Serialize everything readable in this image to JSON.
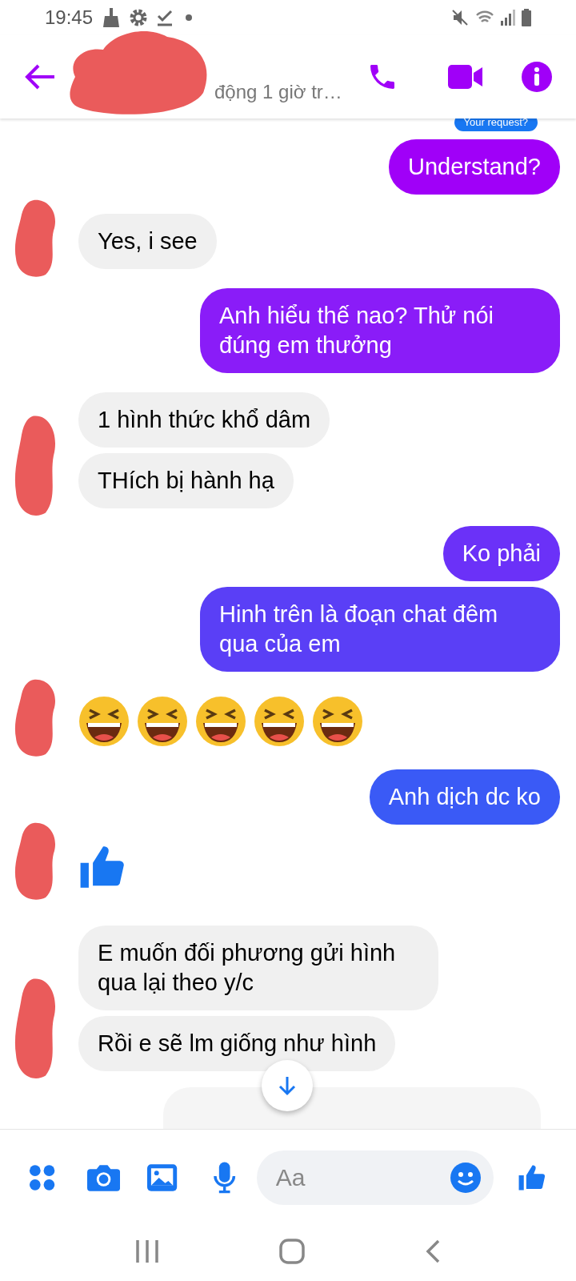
{
  "status_bar": {
    "time": "19:45"
  },
  "header": {
    "subtitle": "động 1 giờ tr…"
  },
  "reply_preview": {
    "text": "Your request?"
  },
  "groups": [
    {
      "kind": "sent",
      "messages": [
        {
          "kind": "text",
          "text": "Understand?",
          "color": "#a000f8"
        }
      ]
    },
    {
      "kind": "received",
      "messages": [
        {
          "kind": "text",
          "text": "Yes, i see"
        }
      ]
    },
    {
      "kind": "sent",
      "messages": [
        {
          "kind": "text",
          "text": "Anh hiểu thế nao? Thử nói đúng em thưởng",
          "color": "#8a1cf8"
        }
      ]
    },
    {
      "kind": "received",
      "messages": [
        {
          "kind": "text",
          "text": "1 hình thức khổ dâm"
        },
        {
          "kind": "text",
          "text": "THích bị hành hạ"
        }
      ]
    },
    {
      "kind": "sent",
      "messages": [
        {
          "kind": "text",
          "text": "Ko phải",
          "color": "#6b31f8"
        },
        {
          "kind": "text",
          "text": "Hinh trên là đoạn chat đêm qua của em",
          "color": "#5a3ff6"
        }
      ]
    },
    {
      "kind": "received",
      "messages": [
        {
          "kind": "emojis",
          "emojis": [
            {
              "kind": "laughing"
            },
            {
              "kind": "laughing"
            },
            {
              "kind": "laughing"
            },
            {
              "kind": "laughing"
            },
            {
              "kind": "laughing"
            }
          ]
        }
      ]
    },
    {
      "kind": "sent",
      "messages": [
        {
          "kind": "text",
          "text": "Anh dịch dc ko",
          "color": "#3a5af6"
        }
      ]
    },
    {
      "kind": "received",
      "messages": [
        {
          "kind": "like"
        }
      ]
    },
    {
      "kind": "received",
      "messages": [
        {
          "kind": "text",
          "text": "E muốn đối phương gửi hình qua lại theo y/c"
        },
        {
          "kind": "text",
          "text": "Rồi e sẽ lm giống như hình"
        }
      ]
    }
  ],
  "composer": {
    "placeholder": "Aa"
  }
}
